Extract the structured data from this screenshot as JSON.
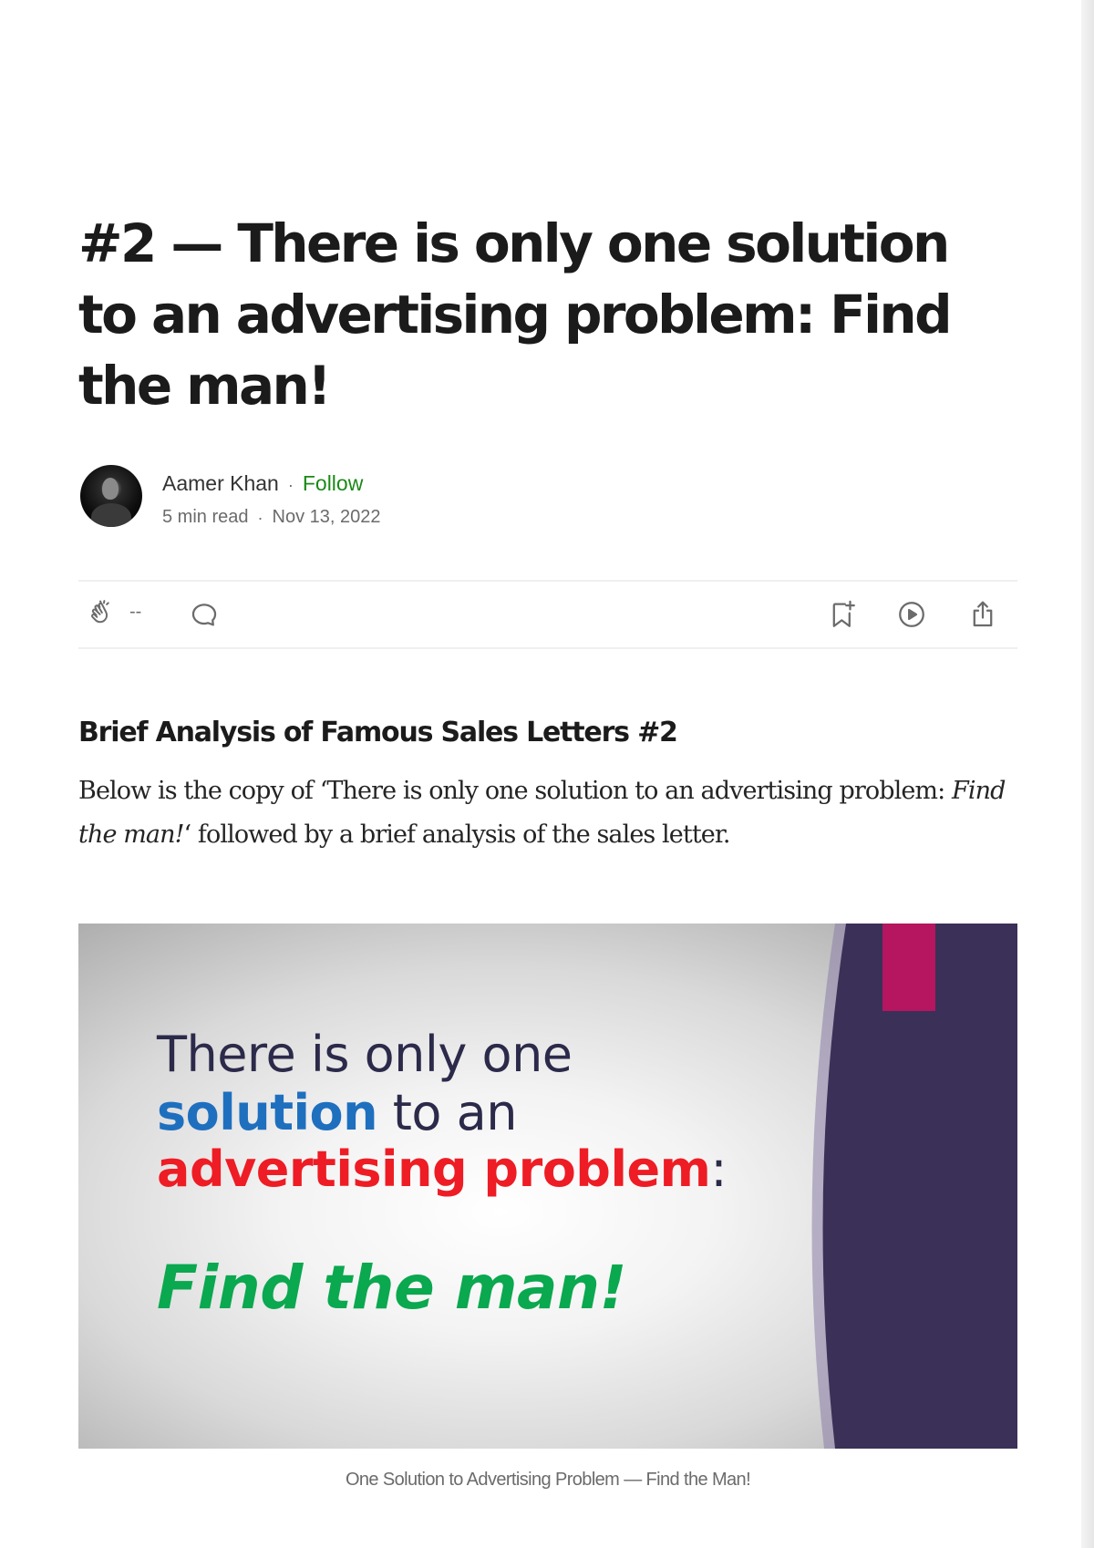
{
  "article": {
    "title": "#2 — There is only one solution to an advertising problem: Find the man!",
    "author": {
      "name": "Aamer Khan",
      "follow_label": "Follow",
      "read_time": "5 min read",
      "date": "Nov 13, 2022"
    },
    "actions": {
      "clap_count": "--",
      "icons": [
        "clap-icon",
        "comment-icon",
        "bookmark-add-icon",
        "play-icon",
        "share-icon"
      ]
    },
    "subheading": "Brief Analysis of Famous Sales Letters #2",
    "intro": {
      "part1": "Below is the copy of ‘There is only one solution to an advertising problem: ",
      "emphasis": "Find the man!",
      "part2": "‘ followed by a brief analysis of the sales letter."
    },
    "figure": {
      "line1": "There is only one",
      "line2_highlight": "solution",
      "line2_rest": " to an",
      "line3_highlight": "advertising problem",
      "line3_rest": ":",
      "line4": "Find the man!",
      "caption": "One Solution to Advertising Problem — Find the Man!"
    }
  },
  "colors": {
    "follow": "#1a8917",
    "slide_blue": "#1f6fbf",
    "slide_red": "#ee1c24",
    "slide_green": "#0aa84f",
    "slide_purple": "#3b3058",
    "slide_ribbon": "#b5165f"
  }
}
